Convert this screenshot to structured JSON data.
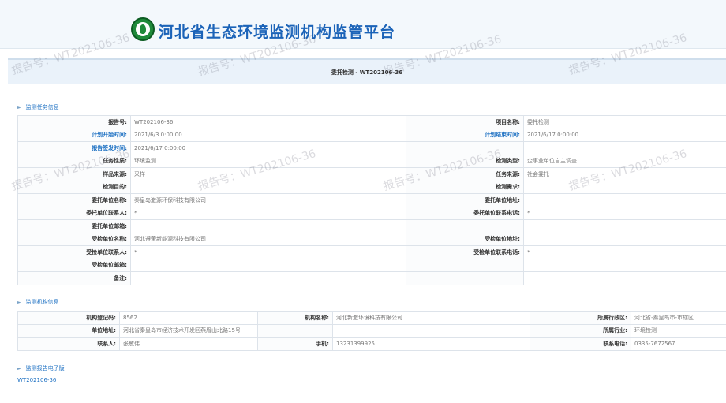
{
  "header": {
    "title": "河北省生态环境监测机构监管平台"
  },
  "page_title": "委托检测 - WT202106-36",
  "task_section": {
    "title": "监测任务信息",
    "rows": [
      [
        "报告号:",
        "WT202106-36",
        "项目名称:",
        "委托检测"
      ],
      [
        "计划开始时间:",
        "2021/6/3 0:00:00",
        "计划结束时间:",
        "2021/6/17 0:00:00"
      ],
      [
        "报告签发时间:",
        "2021/6/17 0:00:00",
        "",
        ""
      ],
      [
        "任务性质:",
        "环境监测",
        "检测类型:",
        "企事业单位自主调查"
      ],
      [
        "样品来源:",
        "采样",
        "任务来源:",
        "社会委托"
      ],
      [
        "检测目的:",
        "",
        "检测需求:",
        ""
      ],
      [
        "委托单位名称:",
        "秦皇岛澈源环保科技有限公司",
        "委托单位地址:",
        ""
      ],
      [
        "委托单位联系人:",
        "*",
        "委托单位联系电话:",
        "*"
      ],
      [
        "委托单位邮箱:",
        "",
        "",
        ""
      ],
      [
        "受检单位名称:",
        "河北遵荣新能源科技有限公司",
        "受检单位地址:",
        ""
      ],
      [
        "受检单位联系人:",
        "*",
        "受检单位联系电话:",
        "*"
      ],
      [
        "受检单位邮箱:",
        "",
        "",
        ""
      ],
      [
        "备注:",
        "",
        "",
        ""
      ]
    ]
  },
  "org_section": {
    "title": "监测机构信息",
    "rows": [
      [
        "机构登记码:",
        "8562",
        "机构名称:",
        "河北新澈环境科技有限公司",
        "所属行政区:",
        "河北省-秦皇岛市-市辖区"
      ],
      [
        "单位地址:",
        "河北省秦皇岛市经济技术开发区燕眉山北路15号",
        "",
        "",
        "所属行业:",
        "环境检测"
      ],
      [
        "联系人:",
        "张敏伟",
        "手机:",
        "13231399925",
        "联系电话:",
        "0335-7672567"
      ]
    ]
  },
  "pdf_section": {
    "title": "监测报告电子版",
    "link": "WT202106-36"
  },
  "watermark": "报告号：WT202106-36"
}
